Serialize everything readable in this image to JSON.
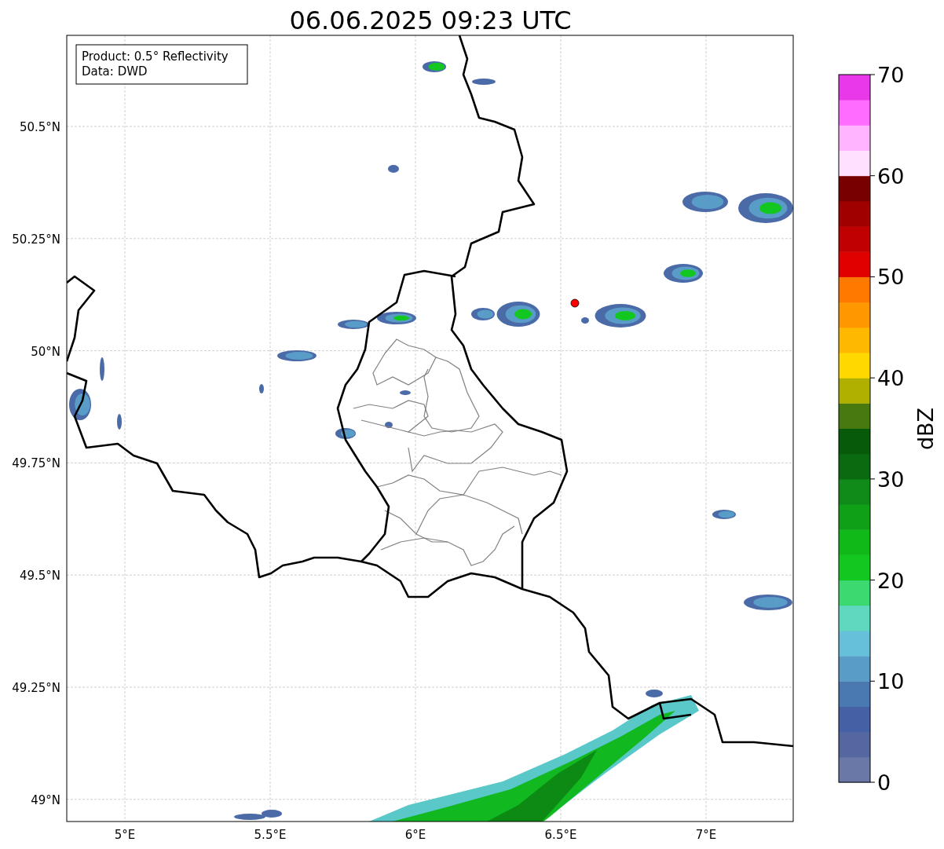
{
  "title": "06.06.2025 09:23 UTC",
  "map": {
    "kind": "map",
    "legend": [
      "Product: 0.5° Reflectivity",
      "Data: DWD"
    ],
    "lat_ticks": [
      "50.5°N",
      "50.25°N",
      "50°N",
      "49.75°N",
      "49.5°N",
      "49.25°N",
      "49°N"
    ],
    "lon_ticks": [
      "5°E",
      "5.5°E",
      "6°E",
      "6.5°E",
      "7°E"
    ]
  },
  "colorbar": {
    "label": "dBZ",
    "ticks": [
      "70",
      "60",
      "50",
      "40",
      "30",
      "20",
      "10",
      "0"
    ],
    "bins": [
      {
        "color": "#6a78a8"
      },
      {
        "color": "#5567a0"
      },
      {
        "color": "#4560a4"
      },
      {
        "color": "#4a78b0"
      },
      {
        "color": "#5a9cc8"
      },
      {
        "color": "#66c0da"
      },
      {
        "color": "#60d8c0"
      },
      {
        "color": "#3cd870"
      },
      {
        "color": "#12c820"
      },
      {
        "color": "#10b818"
      },
      {
        "color": "#10a018"
      },
      {
        "color": "#108a18"
      },
      {
        "color": "#0a6a10"
      },
      {
        "color": "#065a0a"
      },
      {
        "color": "#487810"
      },
      {
        "color": "#b0b000"
      },
      {
        "color": "#ffd800"
      },
      {
        "color": "#ffb800"
      },
      {
        "color": "#ff9800"
      },
      {
        "color": "#ff7800"
      },
      {
        "color": "#e00000"
      },
      {
        "color": "#c00000"
      },
      {
        "color": "#a00000"
      },
      {
        "color": "#780000"
      },
      {
        "color": "#ffe0ff"
      },
      {
        "color": "#ffb4ff"
      },
      {
        "color": "#ff6cff"
      },
      {
        "color": "#e838e8"
      }
    ]
  }
}
